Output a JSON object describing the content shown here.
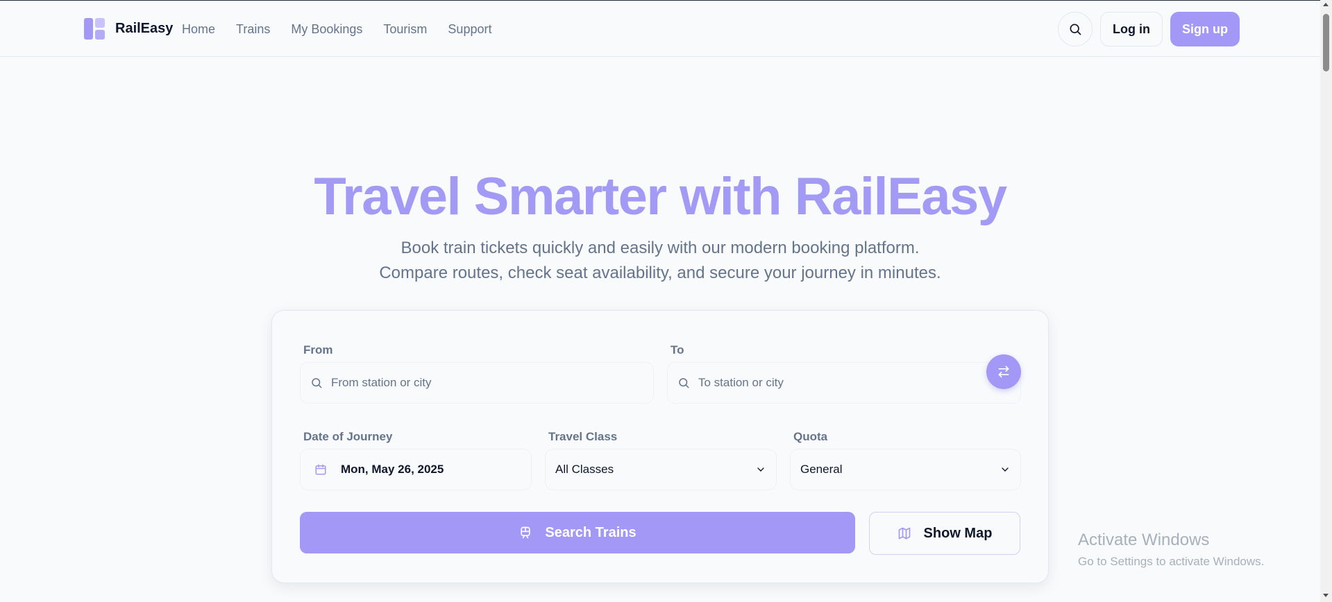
{
  "brand": {
    "name": "RailEasy"
  },
  "nav": {
    "items": [
      "Home",
      "Trains",
      "My Bookings",
      "Tourism",
      "Support"
    ]
  },
  "header": {
    "login_label": "Log in",
    "signup_label": "Sign up"
  },
  "hero": {
    "title": "Travel Smarter with RailEasy",
    "subtitle_line1": "Book train tickets quickly and easily with our modern booking platform.",
    "subtitle_line2": "Compare routes, check seat availability, and secure your journey in minutes."
  },
  "form": {
    "from_label": "From",
    "from_placeholder": "From station or city",
    "to_label": "To",
    "to_placeholder": "To station or city",
    "date_label": "Date of Journey",
    "date_value": "Mon, May 26, 2025",
    "class_label": "Travel Class",
    "class_value": "All Classes",
    "quota_label": "Quota",
    "quota_value": "General",
    "search_label": "Search Trains",
    "map_label": "Show Map"
  },
  "watermark": {
    "title": "Activate Windows",
    "subtitle": "Go to Settings to activate Windows."
  },
  "colors": {
    "accent": "#a398f5",
    "text_muted": "#64748b",
    "background": "#f8fafc"
  }
}
